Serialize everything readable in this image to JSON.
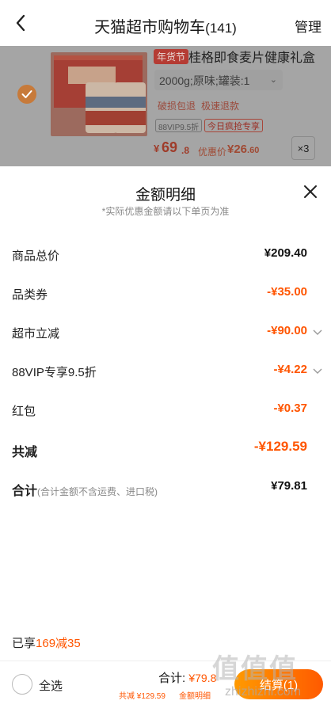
{
  "header": {
    "title": "天猫超市购物车",
    "count": "(141)",
    "manage_label": "管理"
  },
  "product": {
    "year_tag": "年货节",
    "name": "桂格即食麦片健康礼盒",
    "spec": "2000g;原味;罐装:1",
    "promo_tags": [
      "破损包退",
      "极速退款"
    ],
    "vip_tag": "88VIP9.5折",
    "rush_tag": "今日疯抢专享",
    "price_currency": "¥",
    "price_int": "69",
    "price_dec": ".8",
    "discount_label": "优惠价",
    "discount_value": "¥26",
    "discount_dec": ".60",
    "quantity": "×3"
  },
  "sheet": {
    "title": "金额明细",
    "subtitle": "*实际优惠金额请以下单页为准",
    "rows": [
      {
        "label": "商品总价",
        "value": "¥209.40"
      },
      {
        "label": "品类券",
        "value": "-¥35.00"
      },
      {
        "label": "超市立减",
        "value": "-¥90.00"
      },
      {
        "label": "88VIP专享9.5折",
        "value": "-¥4.22"
      },
      {
        "label": "红包",
        "value": "-¥0.37"
      },
      {
        "label": "共减",
        "value": "-¥129.59"
      },
      {
        "label": "合计",
        "note": "(合计金额不含运费、进口税)",
        "value": "¥79.81"
      }
    ],
    "enjoy_prefix": "已享",
    "enjoy_value": "169减35"
  },
  "bottom_bar": {
    "select_all": "全选",
    "total_label": "合计: ",
    "total_value": "¥79.8",
    "reduced": "共减 ¥129.59",
    "detail_link": "金额明细",
    "settle_label": "结算(1)"
  },
  "watermark": {
    "logo": "值值值",
    "url": "zhizhizhi.com"
  },
  "colors": {
    "accent": "#ff5500",
    "overlay": "#a5a5a5"
  }
}
